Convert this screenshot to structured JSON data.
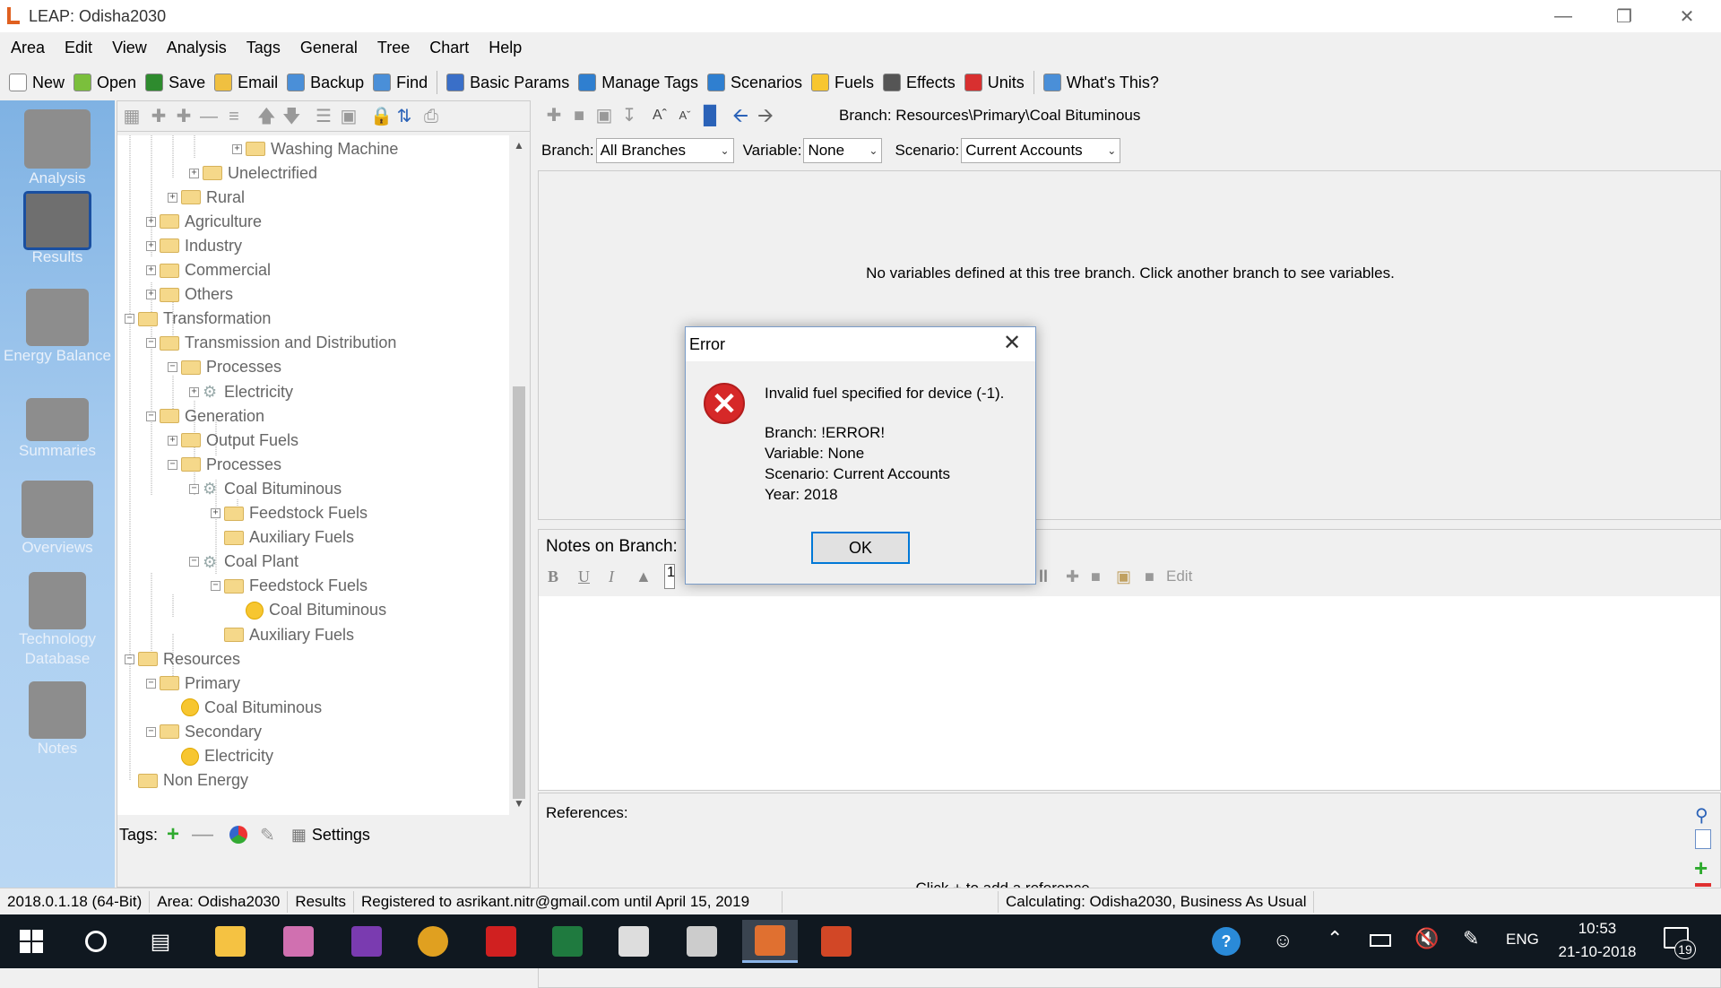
{
  "window": {
    "title": "LEAP: Odisha2030"
  },
  "menu": [
    "Area",
    "Edit",
    "View",
    "Analysis",
    "Tags",
    "General",
    "Tree",
    "Chart",
    "Help"
  ],
  "toolbar": {
    "items": [
      {
        "label": "New",
        "icon": "new-icon",
        "color": "#ffffff"
      },
      {
        "label": "Open",
        "icon": "open-icon",
        "color": "#7bbf3c"
      },
      {
        "label": "Save",
        "icon": "save-icon",
        "color": "#2e8b2e"
      },
      {
        "label": "Email",
        "icon": "email-icon",
        "color": "#f0c040"
      },
      {
        "label": "Backup",
        "icon": "backup-icon",
        "color": "#4a8fd8"
      },
      {
        "label": "Find",
        "icon": "find-icon",
        "color": "#4a8fd8"
      },
      {
        "label": "Basic Params",
        "icon": "basic-params-icon",
        "color": "#3a6fc8"
      },
      {
        "label": "Manage Tags",
        "icon": "manage-tags-icon",
        "color": "#2f7fd0"
      },
      {
        "label": "Scenarios",
        "icon": "scenarios-icon",
        "color": "#2f7fd0"
      },
      {
        "label": "Fuels",
        "icon": "fuels-icon",
        "color": "#f7c630"
      },
      {
        "label": "Effects",
        "icon": "effects-icon",
        "color": "#555555"
      },
      {
        "label": "Units",
        "icon": "units-icon",
        "color": "#d83030"
      },
      {
        "label": "What's This?",
        "icon": "help-icon",
        "color": "#4a8fd8"
      }
    ]
  },
  "leftnav": [
    {
      "label": "Analysis",
      "icon": "analysis-icon"
    },
    {
      "label": "Results",
      "icon": "results-icon"
    },
    {
      "label": "Energy Balance",
      "icon": "energy-balance-icon"
    },
    {
      "label": "Summaries",
      "icon": "summaries-icon"
    },
    {
      "label": "Overviews",
      "icon": "overviews-icon"
    },
    {
      "label": "Technology Database",
      "icon": "technology-database-icon"
    },
    {
      "label": "Notes",
      "icon": "notes-icon"
    }
  ],
  "tree": {
    "nodes": [
      {
        "label": "Washing Machine",
        "expander": "+",
        "icon": "folder",
        "level": 5
      },
      {
        "label": "Unelectrified",
        "expander": "+",
        "icon": "folder",
        "level": 3
      },
      {
        "label": "Rural",
        "expander": "+",
        "icon": "folder",
        "level": 2
      },
      {
        "label": "Agriculture",
        "expander": "+",
        "icon": "folder",
        "level": 1
      },
      {
        "label": "Industry",
        "expander": "+",
        "icon": "folder",
        "level": 1
      },
      {
        "label": "Commercial",
        "expander": "+",
        "icon": "folder",
        "level": 1
      },
      {
        "label": "Others",
        "expander": "+",
        "icon": "folder",
        "level": 1
      },
      {
        "label": "Transformation",
        "expander": "-",
        "icon": "folder",
        "level": 0
      },
      {
        "label": "Transmission and Distribution",
        "expander": "-",
        "icon": "folder",
        "level": 1
      },
      {
        "label": "Processes",
        "expander": "-",
        "icon": "folder",
        "level": 2
      },
      {
        "label": "Electricity",
        "expander": "+",
        "icon": "gear",
        "level": 3
      },
      {
        "label": "Generation",
        "expander": "-",
        "icon": "folder",
        "level": 1
      },
      {
        "label": "Output Fuels",
        "expander": "+",
        "icon": "folder",
        "level": 2
      },
      {
        "label": "Processes",
        "expander": "-",
        "icon": "folder",
        "level": 2
      },
      {
        "label": "Coal Bituminous",
        "expander": "-",
        "icon": "gear",
        "level": 3
      },
      {
        "label": "Feedstock Fuels",
        "expander": "+",
        "icon": "folder",
        "level": 4
      },
      {
        "label": "Auxiliary Fuels",
        "expander": "",
        "icon": "folder",
        "level": 4
      },
      {
        "label": "Coal Plant",
        "expander": "-",
        "icon": "gear",
        "level": 3
      },
      {
        "label": "Feedstock Fuels",
        "expander": "-",
        "icon": "folder",
        "level": 4
      },
      {
        "label": "Coal Bituminous",
        "expander": "",
        "icon": "coin",
        "level": 5
      },
      {
        "label": "Auxiliary Fuels",
        "expander": "",
        "icon": "folder",
        "level": 4
      },
      {
        "label": "Resources",
        "expander": "-",
        "icon": "folder",
        "level": 0
      },
      {
        "label": "Primary",
        "expander": "-",
        "icon": "folder",
        "level": 1
      },
      {
        "label": "Coal Bituminous",
        "expander": "",
        "icon": "coin",
        "level": 2
      },
      {
        "label": "Secondary",
        "expander": "-",
        "icon": "folder",
        "level": 1
      },
      {
        "label": "Electricity",
        "expander": "",
        "icon": "coin",
        "level": 2
      },
      {
        "label": "Non Energy",
        "expander": "",
        "icon": "folder",
        "level": 0
      }
    ]
  },
  "tags": {
    "label": "Tags:",
    "settings": "Settings"
  },
  "branch_path": "Branch: Resources\\Primary\\Coal Bituminous",
  "filters": {
    "branch_label": "Branch:",
    "branch_value": "All Branches",
    "variable_label": "Variable:",
    "variable_value": "None",
    "scenario_label": "Scenario:",
    "scenario_value": "Current Accounts"
  },
  "variables_message": "No variables defined at this tree branch. Click another branch to see variables.",
  "notes": {
    "title": "Notes on Branch:",
    "edit_label": "Edit",
    "font_size": "1"
  },
  "references": {
    "title": "References:",
    "message": "Click + to add a reference."
  },
  "status": [
    "2018.0.1.18 (64-Bit)",
    "Area: Odisha2030",
    "Results",
    "Registered to asrikant.nitr@gmail.com until April 15, 2019",
    "Calculating: Odisha2030, Business As Usual"
  ],
  "dialog": {
    "title": "Error",
    "message": "Invalid fuel specified for device (-1).",
    "branch": "Branch: !ERROR!",
    "variable": "Variable: None",
    "scenario": "Scenario: Current Accounts",
    "year": "Year: 2018",
    "ok": "OK"
  },
  "taskbar": {
    "time": "10:53",
    "date": "21-10-2018",
    "lang": "ENG",
    "notifications": "19",
    "apps": [
      {
        "icon": "file-explorer-icon",
        "color": "#f5c242"
      },
      {
        "icon": "paint-icon",
        "color": "#d070b0"
      },
      {
        "icon": "onenote-icon",
        "color": "#7a3bb0"
      },
      {
        "icon": "chrome-icon",
        "color": "#e0a020"
      },
      {
        "icon": "acrobat-icon",
        "color": "#d02020"
      },
      {
        "icon": "excel-icon",
        "color": "#1f7a3f"
      },
      {
        "icon": "clock-icon",
        "color": "#dddddd"
      },
      {
        "icon": "calculator-icon",
        "color": "#cccccc"
      },
      {
        "icon": "leap-icon",
        "color": "#e07030"
      },
      {
        "icon": "powerpoint-icon",
        "color": "#d24726"
      }
    ]
  }
}
